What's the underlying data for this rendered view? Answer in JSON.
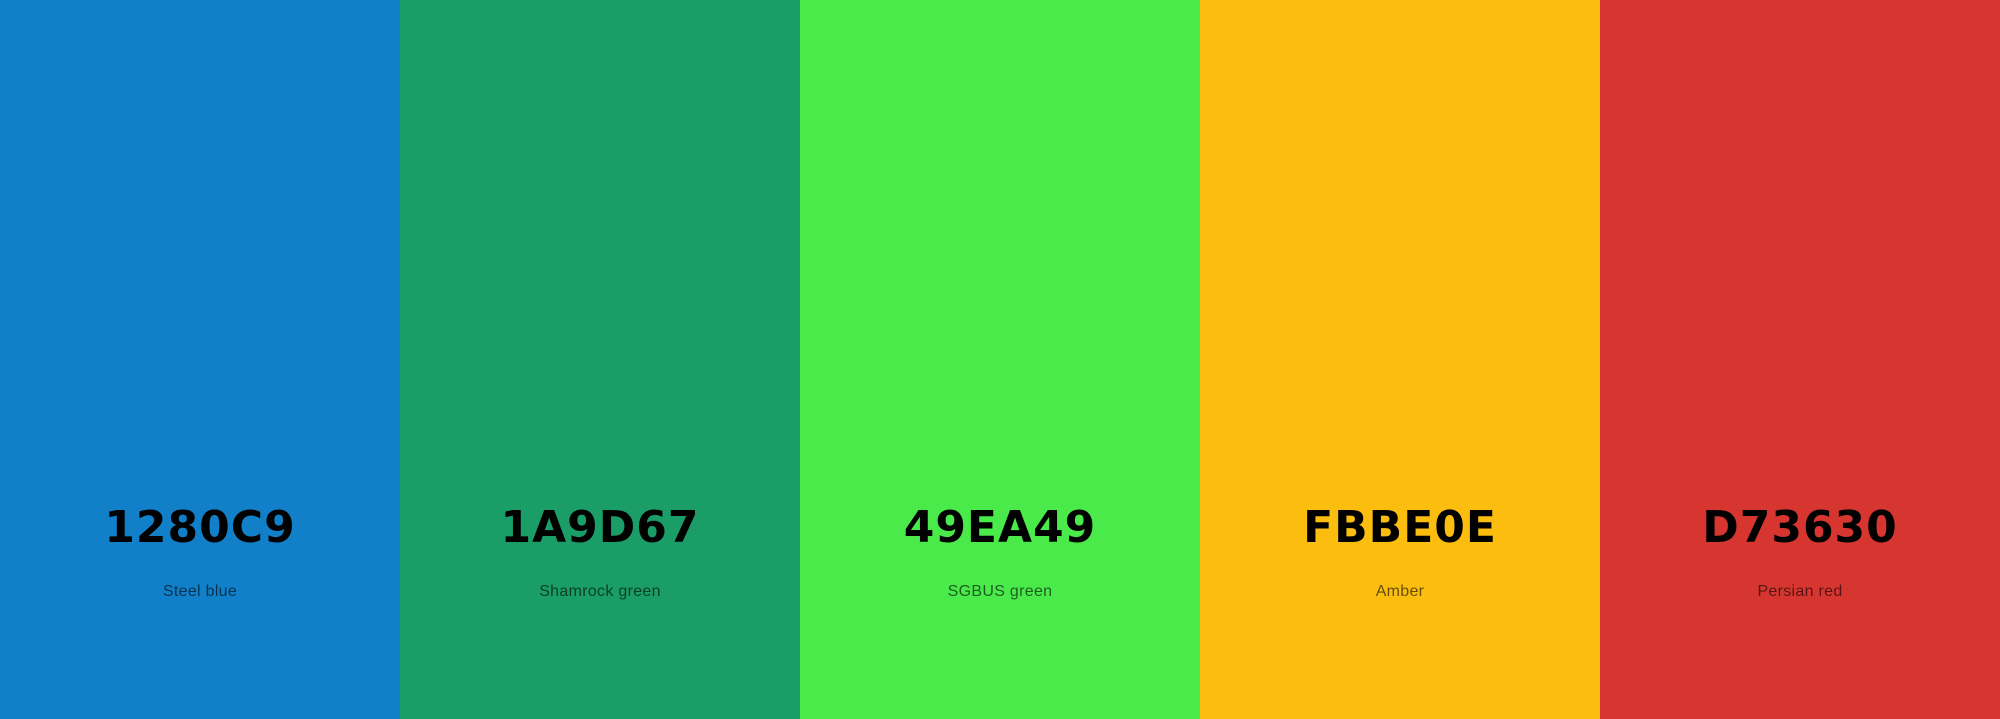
{
  "palette": {
    "swatches": [
      {
        "hex": "1280C9",
        "name": "Steel blue",
        "color": "#1280C9"
      },
      {
        "hex": "1A9D67",
        "name": "Shamrock green",
        "color": "#1A9D67"
      },
      {
        "hex": "49EA49",
        "name": "SGBUS green",
        "color": "#49EA49"
      },
      {
        "hex": "FBBE0E",
        "name": "Amber",
        "color": "#FBBE0E"
      },
      {
        "hex": "D73630",
        "name": "Persian red",
        "color": "#D73630"
      }
    ]
  }
}
